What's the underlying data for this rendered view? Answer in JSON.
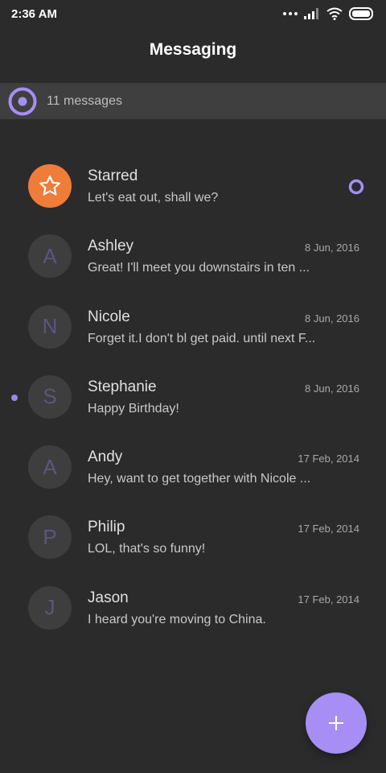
{
  "status_bar": {
    "time": "2:36 AM",
    "icons": [
      "more-dots-icon",
      "signal-icon",
      "wifi-icon",
      "battery-icon"
    ]
  },
  "header": {
    "title": "Messaging"
  },
  "summary": {
    "text": "11 messages",
    "icon": "conversation-ring-icon"
  },
  "colors": {
    "accent": "#a78ef5",
    "starred": "#f07c3a",
    "background": "#2b2b2b",
    "summary_bar": "#3f3f3f"
  },
  "conversations": [
    {
      "name": "Starred",
      "preview": "Let's eat out, shall we?",
      "date": "",
      "initial": "",
      "icon": "star-icon",
      "starred": true,
      "unread": false
    },
    {
      "name": "Ashley",
      "preview": "Great! I'll meet you downstairs in ten ...",
      "date": "8 Jun, 2016",
      "initial": "A",
      "unread": false
    },
    {
      "name": "Nicole",
      "preview": "Forget it.I don't bl get paid. until next F...",
      "date": "8 Jun, 2016",
      "initial": "N",
      "unread": false
    },
    {
      "name": "Stephanie",
      "preview": "Happy Birthday!",
      "date": "8 Jun, 2016",
      "initial": "S",
      "unread": true
    },
    {
      "name": "Andy",
      "preview": "Hey, want to get together with Nicole ...",
      "date": "17 Feb, 2014",
      "initial": "A",
      "unread": false
    },
    {
      "name": "Philip",
      "preview": "LOL, that's so funny!",
      "date": "17 Feb, 2014",
      "initial": "P",
      "unread": false
    },
    {
      "name": "Jason",
      "preview": "I heard you're moving to China.",
      "date": "17 Feb, 2014",
      "initial": "J",
      "unread": false
    }
  ],
  "fab": {
    "icon": "plus-icon"
  }
}
